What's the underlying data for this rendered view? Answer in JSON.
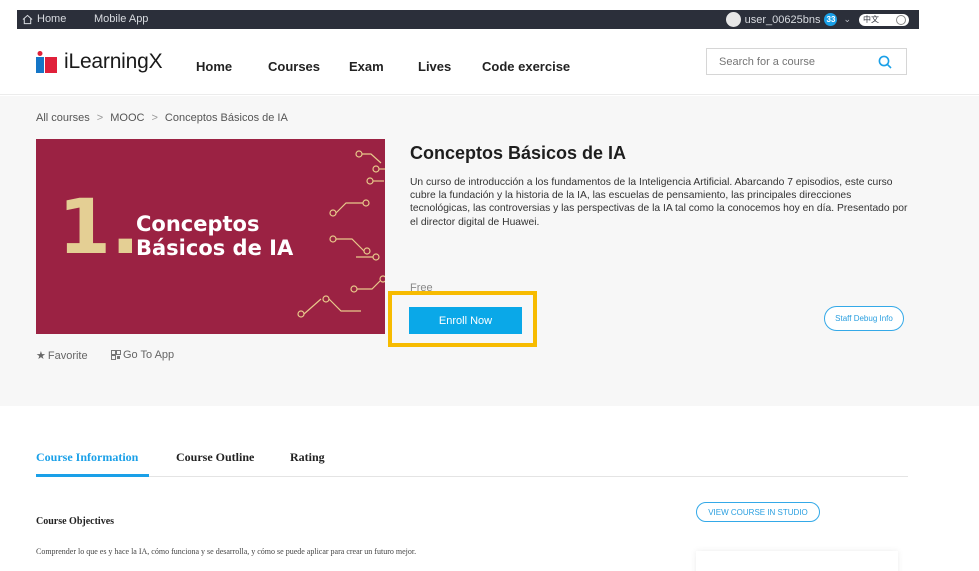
{
  "topbar": {
    "home": "Home",
    "mobile_app": "Mobile App",
    "username": "user_00625bns",
    "notifications": "33",
    "lang": "中文"
  },
  "header": {
    "logo": "iLearningX",
    "nav": [
      "Home",
      "Courses",
      "Exam",
      "Lives",
      "Code exercise"
    ],
    "search_placeholder": "Search for a course"
  },
  "breadcrumb": [
    "All courses",
    "MOOC",
    "Conceptos Básicos de IA"
  ],
  "banner": {
    "number": "1.",
    "line1": "Conceptos",
    "line2": "Básicos de IA"
  },
  "course": {
    "title": "Conceptos Básicos de IA",
    "description": "Un curso de introducción a los fundamentos de la Inteligencia Artificial. Abarcando 7 episodios, este curso cubre la fundación y la historia de la IA, las escuelas de pensamiento, las principales direcciones tecnológicas, las controversias y las perspectivas de la IA tal como la conocemos hoy en día. Presentado por el director digital de Huawei.",
    "price": "Free",
    "enroll": "Enroll Now",
    "debug": "Staff Debug Info",
    "favorite": "Favorite",
    "go_to_app": "Go To App"
  },
  "tabs": [
    "Course Information",
    "Course Outline",
    "Rating"
  ],
  "studio_button": "VIEW COURSE IN STUDIO",
  "objectives": {
    "title": "Course Objectives",
    "text": "Comprender lo que es y hace la IA, cómo funciona y se desarrolla, y cómo se puede aplicar para crear un futuro mejor."
  },
  "colors": {
    "accent": "#0aa8e8",
    "banner": "#9b2243",
    "highlight": "#f7bb00",
    "topbar": "#2b2f3a"
  }
}
